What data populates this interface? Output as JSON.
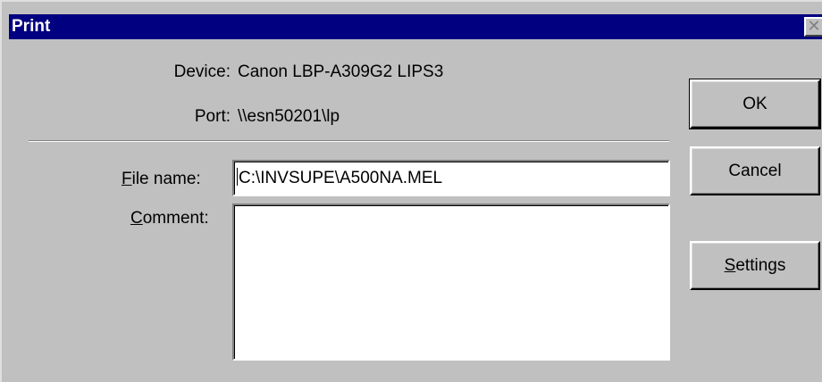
{
  "window": {
    "title": "Print",
    "close_glyph": "✕"
  },
  "info": {
    "device_label": "Device:",
    "device_value": "Canon LBP-A309G2 LIPS3",
    "port_label": "Port:",
    "port_value": "\\\\esn50201\\lp"
  },
  "form": {
    "file_name_label_mnemonic": "F",
    "file_name_label_rest": "ile name:",
    "file_name_value": "C:\\INVSUPE\\A500NA.MEL",
    "comment_label_mnemonic": "C",
    "comment_label_rest": "omment:",
    "comment_value": ""
  },
  "buttons": {
    "ok": "OK",
    "cancel": "Cancel",
    "settings_mnemonic": "S",
    "settings_rest": "ettings"
  },
  "icons": {
    "close": "close-icon"
  }
}
